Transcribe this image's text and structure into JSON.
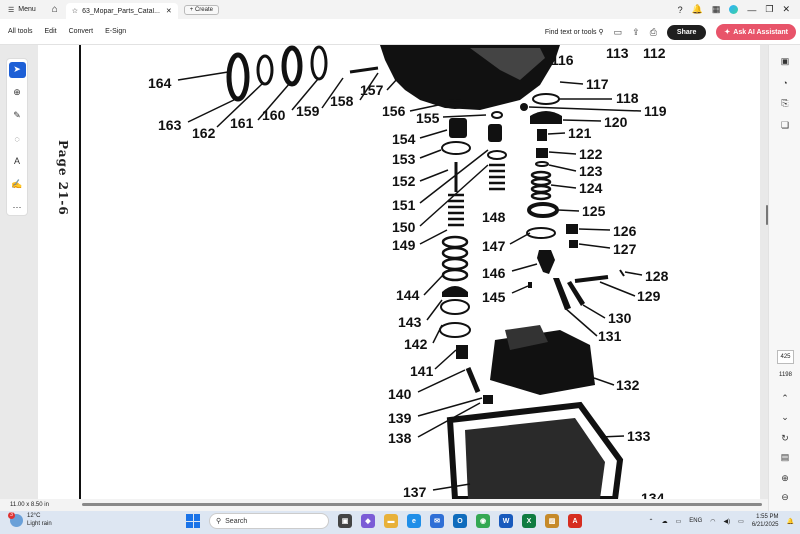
{
  "titlebar": {
    "menu_label": "Menu",
    "tab_title": "63_Mopar_Parts_Catal...",
    "create_label": "Create"
  },
  "toolbar": {
    "menu_items": [
      "All tools",
      "Edit",
      "Convert",
      "E-Sign"
    ],
    "find_label": "Find text or tools",
    "share_label": "Share",
    "ai_label": "Ask AI Assistant"
  },
  "document": {
    "page_label": "Page 21-6",
    "size_label": "11.00 x 8.50 in",
    "current_page": "425",
    "total_pages": "1198"
  },
  "diagram": {
    "parts": [
      "164",
      "163",
      "162",
      "161",
      "160",
      "159",
      "158",
      "157",
      "156",
      "155",
      "154",
      "153",
      "152",
      "151",
      "150",
      "149",
      "148",
      "147",
      "146",
      "145",
      "144",
      "143",
      "142",
      "141",
      "140",
      "139",
      "138",
      "137",
      "116",
      "113",
      "112",
      "117",
      "118",
      "119",
      "120",
      "121",
      "122",
      "123",
      "124",
      "125",
      "126",
      "127",
      "128",
      "129",
      "130",
      "131",
      "132",
      "133",
      "134"
    ]
  },
  "taskbar": {
    "weather_temp": "12°C",
    "weather_desc": "Light rain",
    "weather_badge": "3",
    "search_label": "Search",
    "lang": "ENG",
    "time": "1:55 PM",
    "date": "6/21/2025"
  },
  "colors": {
    "accent": "#1d5fd6",
    "ai_button": "#e8546a",
    "share_button": "#1f1f1f"
  }
}
